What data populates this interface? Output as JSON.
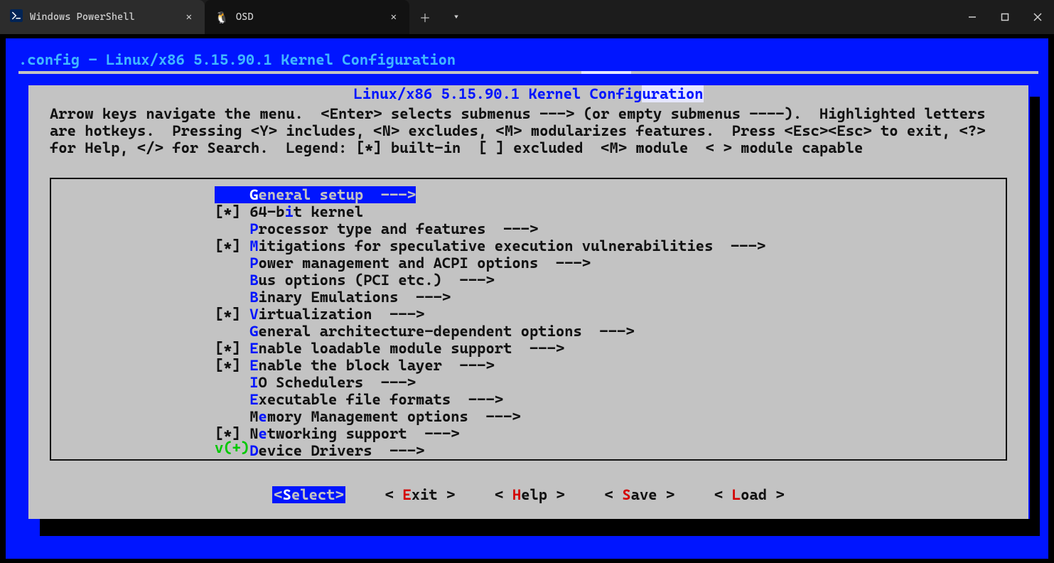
{
  "tabs": {
    "inactive_label": "Windows PowerShell",
    "active_label": "OSD"
  },
  "config_title": ".config - Linux/x86 5.15.90.1 Kernel Configuration",
  "panel_title_plain": "Linux/x86 5.15.90.1 Kernel Config",
  "panel_title_highlight": "uration",
  "help_text": "Arrow keys navigate the menu.  <Enter> selects submenus ---> (or empty submenus ----).  Highlighted letters\nare hotkeys.  Pressing <Y> includes, <N> excludes, <M> modularizes features.  Press <Esc><Esc> to exit, <?>\nfor Help, </> for Search.  Legend: [*] built-in  [ ] excluded  <M> module  < > module capable",
  "menu": [
    {
      "mark": "   ",
      "pre": "",
      "hk": "G",
      "post": "eneral setup  --->",
      "selected": true
    },
    {
      "mark": "[*]",
      "pre": "64-b",
      "hk": "i",
      "post": "t kernel"
    },
    {
      "mark": "   ",
      "pre": "",
      "hk": "P",
      "post": "rocessor type and features  --->"
    },
    {
      "mark": "[*]",
      "pre": "",
      "hk": "M",
      "post": "itigations for speculative execution vulnerabilities  --->"
    },
    {
      "mark": "   ",
      "pre": "",
      "hk": "P",
      "post": "ower management and ACPI options  --->"
    },
    {
      "mark": "   ",
      "pre": "",
      "hk": "B",
      "post": "us options (PCI etc.)  --->"
    },
    {
      "mark": "   ",
      "pre": "",
      "hk": "B",
      "post": "inary Emulations  --->"
    },
    {
      "mark": "[*]",
      "pre": "",
      "hk": "V",
      "post": "irtualization  --->"
    },
    {
      "mark": "   ",
      "pre": "",
      "hk": "G",
      "post": "eneral architecture-dependent options  --->"
    },
    {
      "mark": "[*]",
      "pre": "",
      "hk": "E",
      "post": "nable loadable module support  --->"
    },
    {
      "mark": "[*]",
      "pre": "",
      "hk": "E",
      "post": "nable the block layer  --->"
    },
    {
      "mark": "   ",
      "pre": "",
      "hk": "I",
      "post": "O Schedulers  --->"
    },
    {
      "mark": "   ",
      "pre": "",
      "hk": "E",
      "post": "xecutable file formats  --->"
    },
    {
      "mark": "   ",
      "pre": "M",
      "hk": "e",
      "post": "mory Management options  --->"
    },
    {
      "mark": "[*]",
      "pre": "N",
      "hk": "e",
      "post": "tworking support  --->"
    },
    {
      "mark": "   ",
      "pre": "",
      "hk": "D",
      "post": "evice Drivers  --->"
    }
  ],
  "more_indicator": "v(+)",
  "buttons": [
    {
      "open": "<",
      "hot": "S",
      "rest": "elect",
      ">": ">",
      "selected": true
    },
    {
      "open": "< ",
      "hot": "E",
      "rest": "xit",
      " >": " >"
    },
    {
      "open": "< ",
      "hot": "H",
      "rest": "elp",
      " >": " >"
    },
    {
      "open": "< ",
      "hot": "S",
      "rest": "ave",
      " >": " >"
    },
    {
      "open": "< ",
      "hot": "L",
      "rest": "oad",
      " >": " >"
    }
  ]
}
